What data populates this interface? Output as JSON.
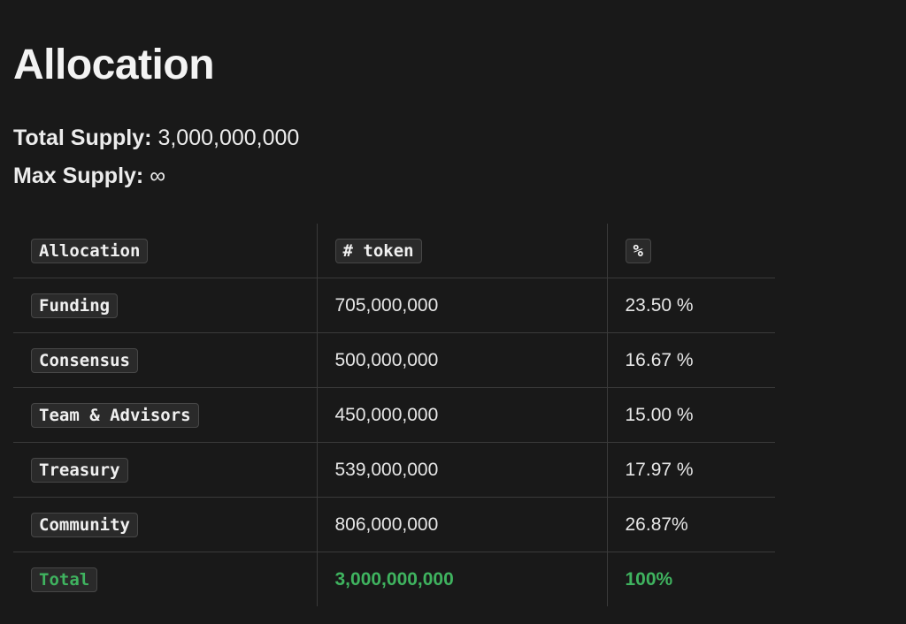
{
  "title": "Allocation",
  "supply": {
    "total_label": "Total Supply:",
    "total_value": "3,000,000,000",
    "max_label": "Max Supply:",
    "max_value": "∞"
  },
  "table": {
    "headers": [
      "Allocation",
      "# token",
      "%"
    ],
    "rows": [
      {
        "allocation": "Funding",
        "tokens": "705,000,000",
        "percent": "23.50 %"
      },
      {
        "allocation": "Consensus",
        "tokens": "500,000,000",
        "percent": "16.67 %"
      },
      {
        "allocation": "Team & Advisors",
        "tokens": "450,000,000",
        "percent": "15.00 %"
      },
      {
        "allocation": "Treasury",
        "tokens": "539,000,000",
        "percent": "17.97 %"
      },
      {
        "allocation": "Community",
        "tokens": "806,000,000",
        "percent": "26.87%"
      }
    ],
    "total": {
      "allocation": "Total",
      "tokens": "3,000,000,000",
      "percent": "100%"
    }
  },
  "colors": {
    "background": "#191919",
    "text": "#ececec",
    "total_green": "#3fb35f",
    "border": "#3a3a3a"
  }
}
